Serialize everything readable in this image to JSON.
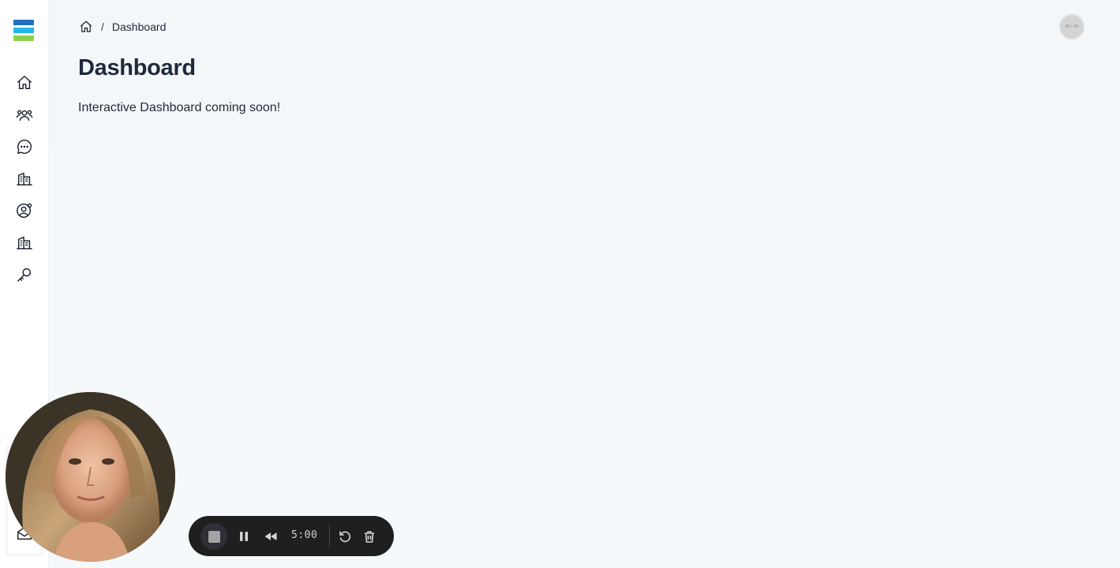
{
  "brand": {
    "logo_colors": [
      "#1f6fbf",
      "#22b7e6",
      "#8fd14f"
    ]
  },
  "sidebar": {
    "items": [
      {
        "name": "home",
        "icon": "home-icon"
      },
      {
        "name": "users",
        "icon": "users-icon"
      },
      {
        "name": "messages",
        "icon": "chat-bubble-icon"
      },
      {
        "name": "companies",
        "icon": "building-icon"
      },
      {
        "name": "account-settings",
        "icon": "user-gear-icon"
      },
      {
        "name": "buildings",
        "icon": "building-icon"
      },
      {
        "name": "keys",
        "icon": "key-icon"
      }
    ],
    "bottom_item": {
      "name": "mail",
      "icon": "mail-icon"
    }
  },
  "breadcrumb": {
    "home_icon": "home-icon",
    "separator": "/",
    "current": "Dashboard"
  },
  "main": {
    "title": "Dashboard",
    "message": "Interactive Dashboard coming soon!"
  },
  "header": {
    "avatar_text": "60 × 60"
  },
  "recorder": {
    "time": "5:00",
    "controls": [
      "stop-icon",
      "pause-icon",
      "rewind-icon",
      "restart-icon",
      "trash-icon"
    ]
  }
}
